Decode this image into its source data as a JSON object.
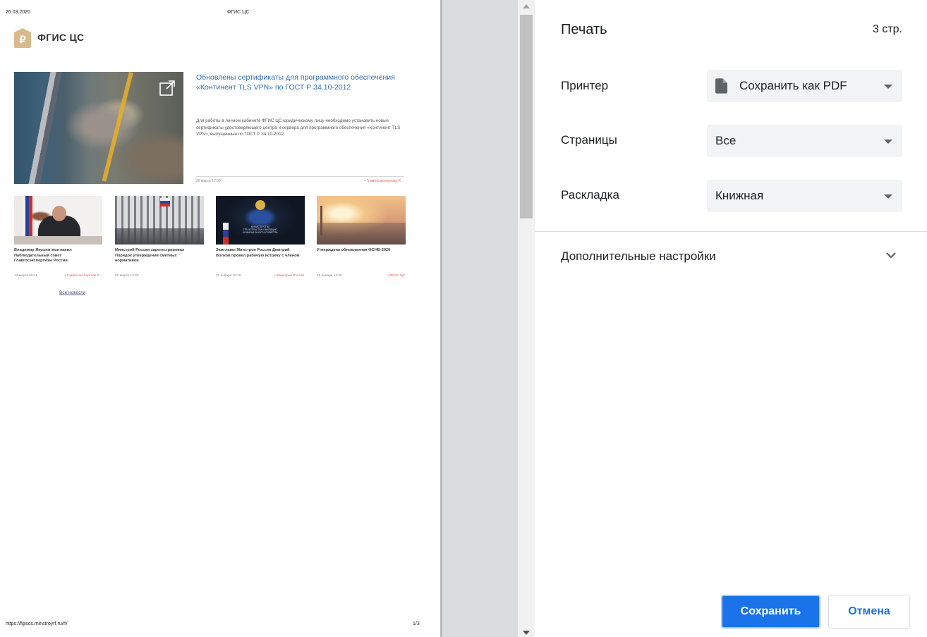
{
  "preview": {
    "header_date": "26.03.2020",
    "header_title": "ФГИС ЦС",
    "footer_url": "https://fgiscs.minstroyrf.ru/#/",
    "footer_page": "1/3",
    "site": {
      "name": "ФГИС ЦС"
    },
    "hero": {
      "title": "Обновлены сертификаты для программного обеспечения «Континент TLS VPN» по ГОСТ Р 34.10-2012",
      "text": "Для работы в личном кабинете ФГИС ЦС юридическому лицу необходимо установить новые сертификаты удостоверяющего центра и сервера для программного обеспечения «Континент TLS VPN», выпущенные по ГОСТ Р 34.10-2012.",
      "date": "26 марта 17:00",
      "source": "• Главгосэкспертиза Р..."
    },
    "news": [
      {
        "title": "Владимир Якушев возглавил Наблюдательный совет Главгосэкспертизы России",
        "date": "13 марта 08:16",
        "source": "• Главгосэкспертиза Р..."
      },
      {
        "title": "Минстрой России зарегистрировал Порядок утверждения сметных нормативов",
        "date": "02 марта 13:30",
        "source": ""
      },
      {
        "title": "Замглавы Минстроя России Дмитрий Волков провел рабочую встречу с членом",
        "date": "30 января 10:18",
        "source": "• Минстрой России"
      },
      {
        "title": "Утверждена обновленная ФСНБ-2020",
        "date": "29 января 14:29",
        "source": "• ФГИС ЦС"
      }
    ],
    "news3_image_text": "МИНИСТЕРСТВО СТРОИТЕЛЬСТВА И ЖИЛИЩНО-КОММУНАЛЬНОГО ХОЗЯЙСТВА",
    "all_news_link": "Все новости"
  },
  "print": {
    "title": "Печать",
    "page_count": "3 стр.",
    "printer": {
      "label": "Принтер",
      "value": "Сохранить как PDF"
    },
    "pages": {
      "label": "Страницы",
      "value": "Все"
    },
    "layout": {
      "label": "Раскладка",
      "value": "Книжная"
    },
    "more_settings": "Дополнительные настройки",
    "save_button": "Сохранить",
    "cancel_button": "Отмена"
  },
  "colors": {
    "accent": "#1a73e8",
    "link": "#2f6db6",
    "source": "#e06060",
    "gutter": "#dadce0",
    "select_bg": "#f1f3f4"
  },
  "icons": {
    "printer": "document-icon",
    "more": "chevron-down-icon",
    "hero": "external-link-icon",
    "logo": "ruble-house-logo"
  }
}
